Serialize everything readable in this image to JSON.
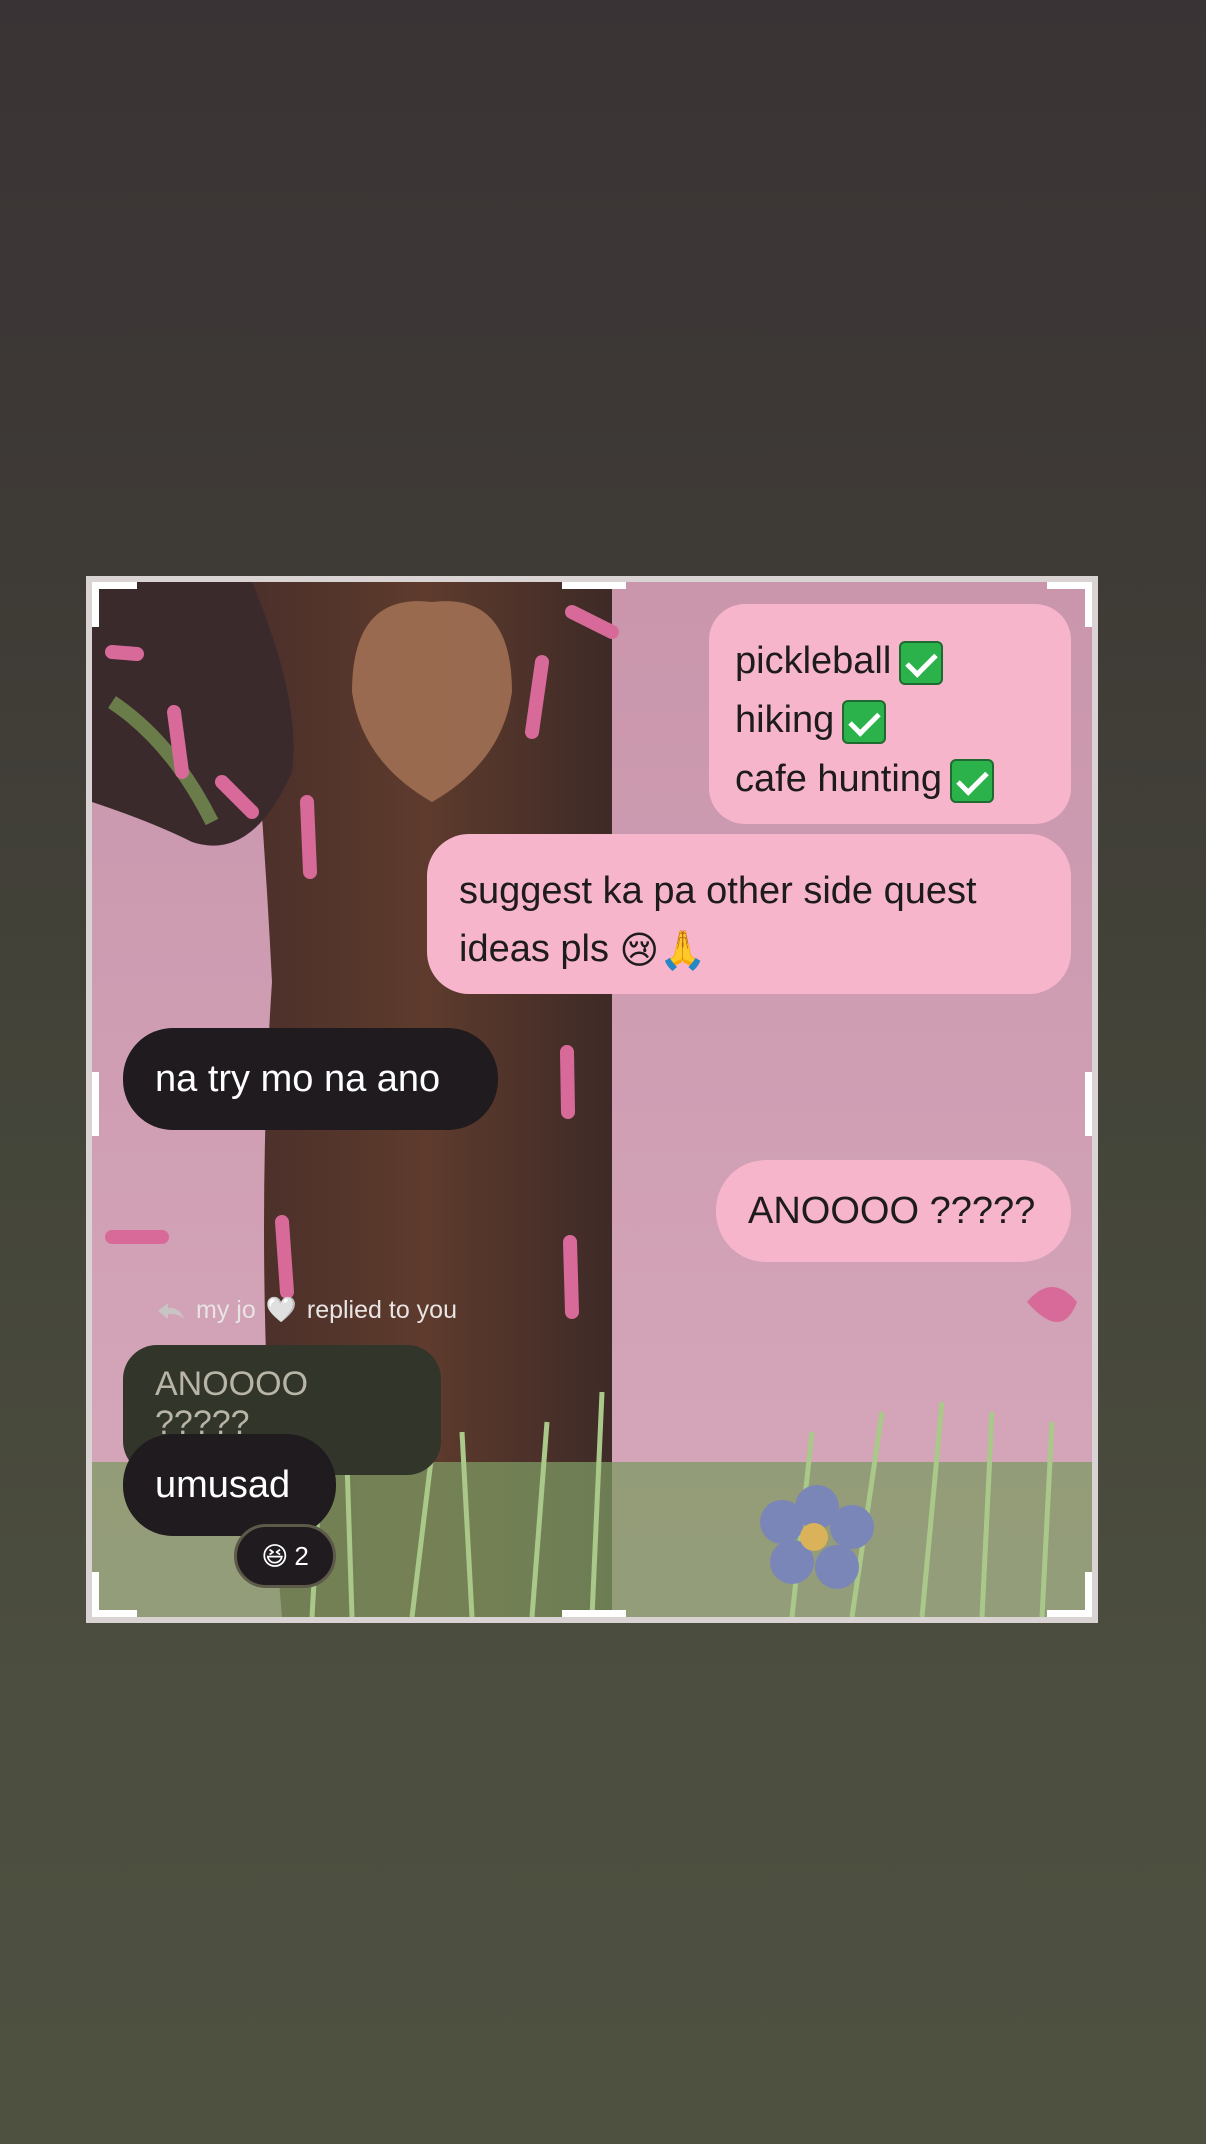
{
  "messages": {
    "out_list": [
      {
        "text": "pickleball",
        "icon": "check-mark-icon"
      },
      {
        "text": "hiking",
        "icon": "check-mark-icon"
      },
      {
        "text": "cafe hunting",
        "icon": "check-mark-icon"
      }
    ],
    "out_suggest": {
      "text": "suggest ka pa other side quest ideas pls",
      "emoji": "😢🙏"
    },
    "in_try": "na try mo na ano",
    "out_anoooo": "ANOOOO ?????",
    "reply_meta": {
      "prefix": "my jo",
      "heart": "🤍",
      "suffix": "replied to you"
    },
    "reply_quote": "ANOOOO ?????",
    "in_umusad": "umusad",
    "reaction": {
      "emoji": "😆",
      "count": "2"
    }
  },
  "colors": {
    "outgoing_bubble": "#f7b5cc",
    "incoming_bubble": "#1f1b1e",
    "check_green": "#2bb24a"
  }
}
